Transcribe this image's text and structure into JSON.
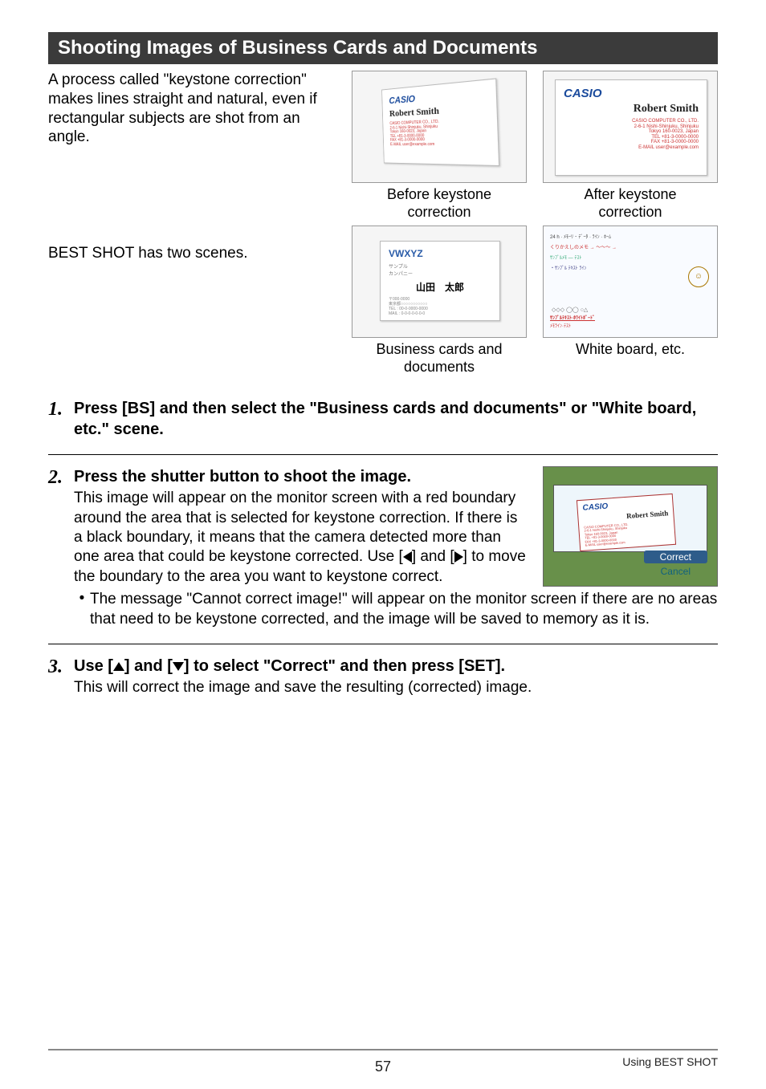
{
  "banner": "Shooting Images of Business Cards and Documents",
  "intro": "A process called \"keystone correction\" makes lines straight and natural, even if rectangular subjects are shot from an angle.",
  "scenes_line": "BEST SHOT has two scenes.",
  "captions": {
    "before": "Before keystone\ncorrection",
    "after": "After keystone\ncorrection",
    "bizdoc": "Business cards and\ndocuments",
    "wb": "White board, etc."
  },
  "card": {
    "brand": "CASIO",
    "name": "Robert Smith",
    "lines": "CASIO COMPUTER CO., LTD.\n2-6-1 Nishi-Shinjuku, Shinjuku\nTokyo 160-0023, Japan\nTEL +81-3-0000-0000\nFAX +81-3-0000-0000\nE-MAIL user@example.com",
    "bizbrand": "VWXYZ",
    "biz_jp": "山田　太郎"
  },
  "steps": {
    "s1": "Press [BS] and then select the \"Business cards and documents\" or \"White board, etc.\" scene.",
    "s2h": "Press the shutter button to shoot the image.",
    "s2b_before": "This image will appear on the monitor screen with a red boundary around the area that is selected for keystone correction. If there is a black boundary, it means that the camera detected more than one area that could be keystone corrected. Use [",
    "s2b_mid": "] and [",
    "s2b_after": "] to move the boundary to the area you want to keystone correct.",
    "s2bullet": "The message \"Cannot correct image!\" will appear on the monitor screen if there are no areas that need to be keystone corrected, and the image will be saved to memory as it is.",
    "s3h_before": "Use [",
    "s3h_mid": "] and [",
    "s3h_after": "] to select \"Correct\" and then press [SET].",
    "s3b": "This will correct the image and save the resulting (corrected) image."
  },
  "menu": {
    "correct": "Correct",
    "cancel": "Cancel"
  },
  "footer": {
    "page": "57",
    "section": "Using BEST SHOT"
  }
}
